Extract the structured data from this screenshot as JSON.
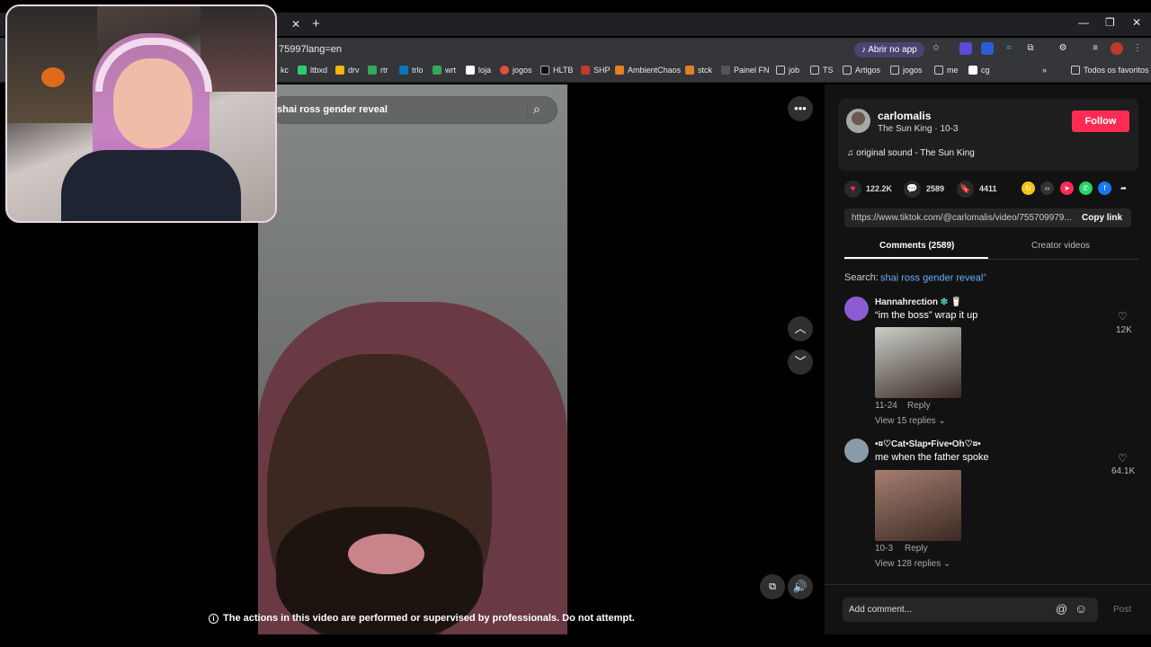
{
  "browser": {
    "url_fragment": "75997lang=en",
    "open_app_label": "Abrir no app",
    "bookmarks": [
      "kc",
      "ltbxd",
      "drv",
      "rtr",
      "trlo",
      "wrt",
      "loja",
      "jogos",
      "HLTB",
      "SHP",
      "AmbientChaos",
      "stck",
      "Painel FN",
      "job",
      "TS",
      "Artigos",
      "jogos",
      "me",
      "cg"
    ],
    "all_bookmarks_label": "Todos os favoritos"
  },
  "video": {
    "search_query": "shai ross gender reveal",
    "disclaimer": "The actions in this video are performed or supervised by professionals. Do not attempt."
  },
  "creator": {
    "username": "carlomalis",
    "subline": "The Sun King · 10-3",
    "follow_label": "Follow",
    "sound": "original sound - The Sun King"
  },
  "stats": {
    "likes": "122.2K",
    "comments": "2589",
    "saves": "4411"
  },
  "link": {
    "url": "https://www.tiktok.com/@carlomalis/video/755709979...",
    "copy_label": "Copy link"
  },
  "tabs": {
    "comments": "Comments (2589)",
    "creator_videos": "Creator videos"
  },
  "search": {
    "label": "Search:",
    "query": "shai ross gender reveal"
  },
  "comments": [
    {
      "user": "Hannahrection",
      "user_suffix": "❇ 🥛",
      "text": "“im the boss” wrap it up",
      "date": "11-24",
      "reply_label": "Reply",
      "replies": "View 15 replies",
      "likes": "12K",
      "avatar_color": "#8a5cd0",
      "img_color": "#c9cfc8"
    },
    {
      "user": "•¤♡Cat•Slap•Five•Oh♡¤•",
      "user_suffix": "",
      "text": "me when the father spoke",
      "date": "10-3",
      "reply_label": "Reply",
      "replies": "View 128 replies",
      "likes": "64.1K",
      "avatar_color": "#8a9aa8",
      "img_color": "#a77e70"
    }
  ],
  "composer": {
    "placeholder": "Add comment...",
    "post_label": "Post"
  },
  "colors": {
    "accent": "#fe2c55",
    "link": "#66b0ff",
    "panel_bg": "#121212"
  }
}
